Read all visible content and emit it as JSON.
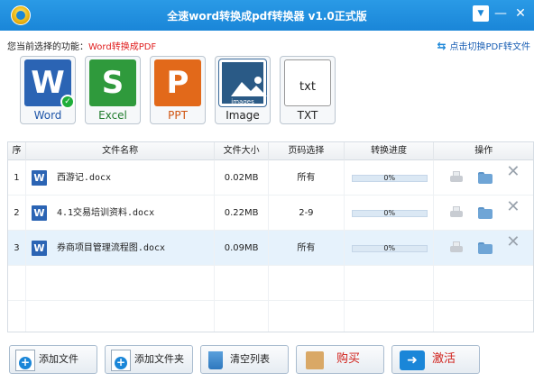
{
  "app": {
    "title": "全速word转换成pdf转换器 v1.0正式版"
  },
  "window_controls": {
    "dropdown": "▼",
    "minimize": "—",
    "close": "✕"
  },
  "func": {
    "prefix": "您当前选择的功能：",
    "current": "Word转换成PDF",
    "switch_label": "点击切换PDF转文件"
  },
  "formats": [
    {
      "label": "Word",
      "glyph": "W",
      "icon": "word-icon",
      "color": "#2b64b4",
      "selected": true
    },
    {
      "label": "Excel",
      "glyph": "S",
      "icon": "excel-icon",
      "color": "#2f9a3c",
      "selected": false
    },
    {
      "label": "PPT",
      "glyph": "P",
      "icon": "ppt-icon",
      "color": "#e2691a",
      "selected": false
    },
    {
      "label": "Image",
      "glyph": "images",
      "icon": "image-icon",
      "color": "#2a5a86",
      "selected": false
    },
    {
      "label": "TXT",
      "glyph": "txt",
      "icon": "txt-icon",
      "color": "#ffffff",
      "selected": false
    }
  ],
  "table": {
    "headers": [
      "序",
      "文件名称",
      "文件大小",
      "页码选择",
      "转换进度",
      "操作"
    ],
    "rows": [
      {
        "no": "1",
        "name": "西游记.docx",
        "size": "0.02MB",
        "pages": "所有",
        "progress": "0%",
        "progress_value": 0
      },
      {
        "no": "2",
        "name": "4.1交易培训资料.docx",
        "size": "0.22MB",
        "pages": "2-9",
        "progress": "0%",
        "progress_value": 0
      },
      {
        "no": "3",
        "name": "券商项目管理流程图.docx",
        "size": "0.09MB",
        "pages": "所有",
        "progress": "0%",
        "progress_value": 0,
        "selected": true
      }
    ]
  },
  "buttons": {
    "add_file": "添加文件",
    "add_folder": "添加文件夹",
    "clear_list": "清空列表",
    "buy": "购买",
    "activate": "激活"
  },
  "colors": {
    "titlebar": "#1a86d8",
    "accent_red": "#d0201a",
    "selected_row": "#e6f2fc"
  }
}
